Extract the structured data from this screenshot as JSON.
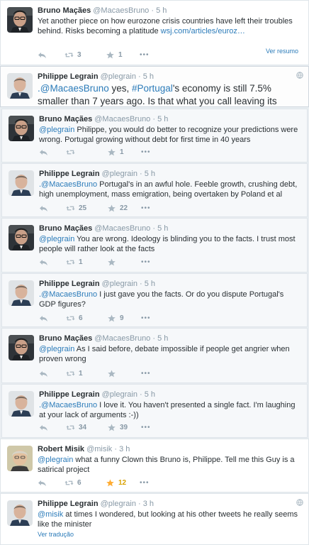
{
  "colors": {
    "link": "#2b7bb9",
    "muted": "#8899a6",
    "favorited": "#d8a100",
    "text": "#292f33"
  },
  "tweets": [
    {
      "name": "Bruno Maçães",
      "handle": "@MacaesBruno",
      "dot": "·",
      "time": "5 h",
      "parts": [
        {
          "text": "Yet another piece on how eurozone crisis countries have left their troubles behind. Risks becoming a platitude "
        },
        {
          "text": "wsj.com/articles/euroz…",
          "cls": "link"
        }
      ],
      "retweets": "3",
      "favorites": "1",
      "favorited": false,
      "more": "•••",
      "footer": "Ver resumo",
      "avatar": "bruno"
    },
    {
      "name": "Philippe Legrain",
      "handle": "@plegrain",
      "dot": "·",
      "time": "5 h",
      "parts": [
        {
          "text": ".@MacaesBruno",
          "cls": "mention"
        },
        {
          "text": " yes, "
        },
        {
          "text": "#Portugal",
          "cls": "hashtag"
        },
        {
          "text": "'s economy is still 7.5% smaller than 7 years ago. Is that what you call leaving its troubles behind?"
        }
      ],
      "retweets": "",
      "favorites": "",
      "favorited": false,
      "more": "",
      "footer": "",
      "avatar": "philippe",
      "globe_icon": "globe-icon"
    },
    {
      "name": "Bruno Maçães",
      "handle": "@MacaesBruno",
      "dot": "·",
      "time": "5 h",
      "parts": [
        {
          "text": "@plegrain",
          "cls": "mention"
        },
        {
          "text": " Philippe, you would do better to recognize your predictions were wrong. Portugal growing without debt for first time in 40 years"
        }
      ],
      "retweets": "",
      "favorites": "1",
      "favorited": false,
      "more": "•••",
      "footer": "",
      "avatar": "bruno"
    },
    {
      "name": "Philippe Legrain",
      "handle": "@plegrain",
      "dot": "·",
      "time": "5 h",
      "parts": [
        {
          "text": ".@MacaesBruno",
          "cls": "mention"
        },
        {
          "text": " Portugal's in an awful hole. Feeble growth, crushing debt, high unemployment, mass emigration, being overtaken by Poland et al"
        }
      ],
      "retweets": "25",
      "favorites": "22",
      "favorited": false,
      "more": "•••",
      "footer": "",
      "avatar": "philippe"
    },
    {
      "name": "Bruno Maçães",
      "handle": "@MacaesBruno",
      "dot": "·",
      "time": "5 h",
      "parts": [
        {
          "text": "@plegrain",
          "cls": "mention"
        },
        {
          "text": " You are wrong. Ideology is blinding you to the facts. I trust most people will rather look at the facts"
        }
      ],
      "retweets": "1",
      "favorites": "",
      "favorited": false,
      "more": "•••",
      "footer": "",
      "avatar": "bruno"
    },
    {
      "name": "Philippe Legrain",
      "handle": "@plegrain",
      "dot": "·",
      "time": "5 h",
      "parts": [
        {
          "text": ".@MacaesBruno",
          "cls": "mention"
        },
        {
          "text": " I just gave you the facts. Or do you dispute Portugal's GDP figures?"
        }
      ],
      "retweets": "6",
      "favorites": "9",
      "favorited": false,
      "more": "•••",
      "footer": "",
      "avatar": "philippe"
    },
    {
      "name": "Bruno Maçães",
      "handle": "@MacaesBruno",
      "dot": "·",
      "time": "5 h",
      "parts": [
        {
          "text": "@plegrain",
          "cls": "mention"
        },
        {
          "text": " As I said before, debate impossible if people get angrier when proven wrong"
        }
      ],
      "retweets": "1",
      "favorites": "",
      "favorited": false,
      "more": "•••",
      "footer": "",
      "avatar": "bruno"
    },
    {
      "name": "Philippe Legrain",
      "handle": "@plegrain",
      "dot": "·",
      "time": "5 h",
      "parts": [
        {
          "text": ".@MacaesBruno",
          "cls": "mention"
        },
        {
          "text": " I love it. You haven't presented a single fact. I'm laughing at your lack of arguments :-))"
        }
      ],
      "retweets": "34",
      "favorites": "39",
      "favorited": false,
      "more": "•••",
      "footer": "",
      "avatar": "philippe"
    },
    {
      "name": "Robert Misik",
      "handle": "@misik",
      "dot": "·",
      "time": "3 h",
      "parts": [
        {
          "text": "@plegrain",
          "cls": "mention"
        },
        {
          "text": " what a funny Clown this Bruno is, Philippe. Tell me this Guy is a satirical project"
        }
      ],
      "retweets": "6",
      "favorites": "12",
      "favorited": true,
      "more": "•••",
      "footer": "",
      "avatar": "robert"
    },
    {
      "name": "Philippe Legrain",
      "handle": "@plegrain",
      "dot": "·",
      "time": "3 h",
      "parts": [
        {
          "text": "@misik",
          "cls": "mention"
        },
        {
          "text": " at times I wondered, but looking at his other tweets he really seems like the minister"
        }
      ],
      "retweets": "",
      "favorites": "",
      "favorited": false,
      "more": "",
      "footer": "Ver tradução",
      "avatar": "philippe",
      "globe_icon": "globe-icon"
    }
  ]
}
